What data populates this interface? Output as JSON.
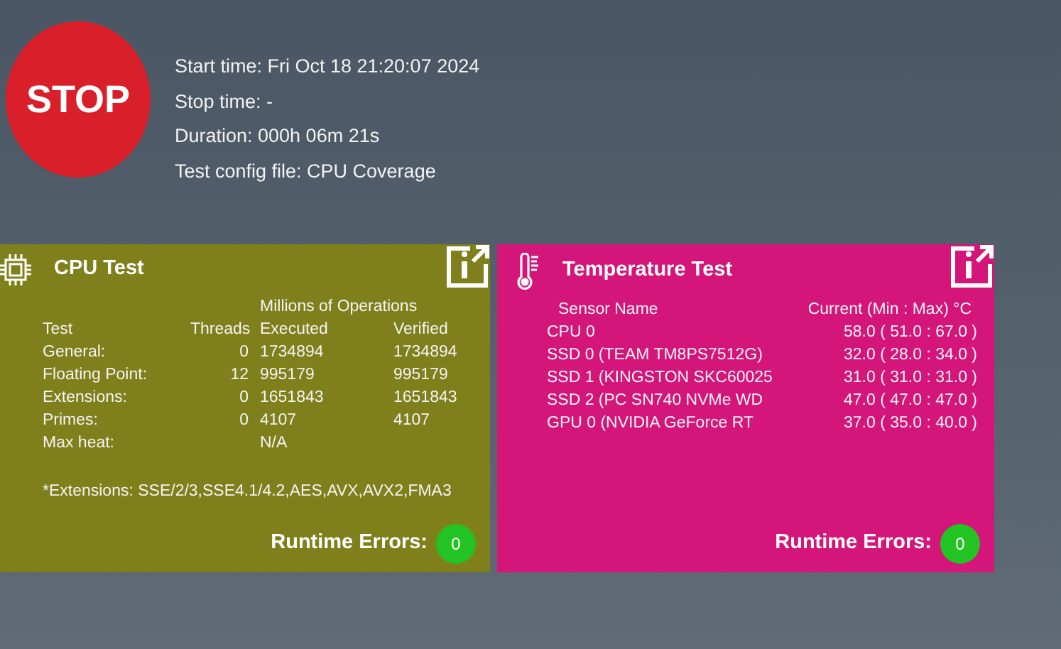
{
  "stop_button": {
    "label": "STOP"
  },
  "run_info": [
    "Start time: Fri Oct 18 21:20:07 2024",
    "Stop time: -",
    "Duration: 000h 06m 21s",
    "Test config file: CPU Coverage"
  ],
  "cpu_test": {
    "title": "CPU Test",
    "group_header": "Millions of Operations",
    "columns": [
      "Test",
      "Threads",
      "Executed",
      "Verified"
    ],
    "rows": [
      [
        "General:",
        "0",
        "1734894",
        "1734894"
      ],
      [
        "Floating Point:",
        "12",
        "995179",
        "995179"
      ],
      [
        "Extensions:",
        "0",
        "1651843",
        "1651843"
      ],
      [
        "Primes:",
        "0",
        "4107",
        "4107"
      ],
      [
        "Max heat:",
        "",
        "N/A",
        ""
      ]
    ],
    "footnote": "*Extensions: SSE/2/3,SSE4.1/4.2,AES,AVX,AVX2,FMA3",
    "errors_label": "Runtime Errors:",
    "errors_count": "0"
  },
  "temperature_test": {
    "title": "Temperature Test",
    "columns": [
      "Sensor Name",
      "Current (Min : Max) °C"
    ],
    "rows": [
      [
        "CPU 0",
        "58.0 ( 51.0 : 67.0 )"
      ],
      [
        "SSD 0 (TEAM TM8PS7512G)",
        "32.0 ( 28.0 : 34.0 )"
      ],
      [
        "SSD 1 (KINGSTON SKC60025",
        "31.0 ( 31.0 : 31.0 )"
      ],
      [
        "SSD 2 (PC SN740 NVMe WD",
        "47.0 ( 47.0 : 47.0 )"
      ],
      [
        "GPU 0 (NVIDIA GeForce RT",
        "37.0 ( 35.0 : 40.0 )"
      ]
    ],
    "errors_label": "Runtime Errors:",
    "errors_count": "0"
  }
}
